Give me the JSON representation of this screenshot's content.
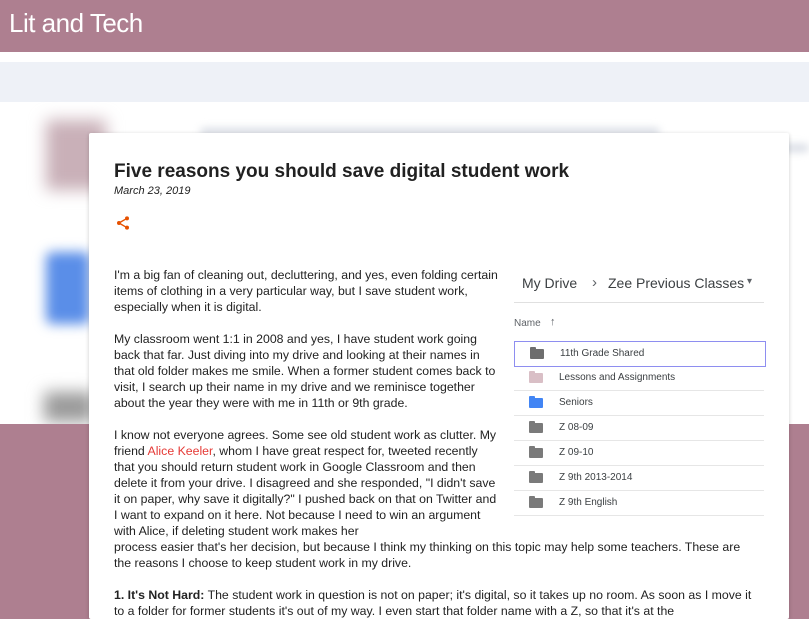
{
  "site": {
    "title": "Lit and Tech"
  },
  "post": {
    "title": "Five reasons you should save digital student work",
    "date": "March 23, 2019",
    "share_icon": "share-icon",
    "paragraphs": {
      "p1": "I'm a big fan of cleaning out, decluttering, and yes, even folding certain items of clothing in a very particular way, but I save student work, especially when it is digital.",
      "p2": "My classroom went 1:1 in 2008 and yes, I have student work going back that far. Just diving into my drive and looking at their names in that old folder makes me smile. When a former student comes back to visit, I search up their name in my drive and we reminisce together about the year they were with me in 11th or 9th grade.",
      "p3_before": "I know not everyone agrees. Some see old student work as clutter. My friend ",
      "p3_link": "Alice Keeler",
      "p3_after": ", whom I have great respect for, tweeted recently that you should return student work in Google Classroom and then delete it from your drive. I disagreed and she responded, \"I didn't save it on paper, why save it digitally?\" I pushed back on that on Twitter and I want to expand on it here. Not because I need to win an argument with Alice, if deleting student work makes her",
      "p4": "process easier that's her decision, but because I think my thinking on this topic may help some teachers. These are the reasons I choose to keep student work in my drive.",
      "p5_bold": "1. It's Not Hard:",
      "p5_text": " The student work in question is not on paper; it's digital, so it takes up no room. As soon as I move it to a folder for former students it's out of my way. I even start that folder name with a Z, so that it's at the"
    }
  },
  "drive": {
    "breadcrumb_root": "My Drive",
    "breadcrumb_sep": "›",
    "breadcrumb_current": "Zee Previous Classes",
    "breadcrumb_caret": "▾",
    "column_name": "Name",
    "sort_arrow": "↑",
    "folders": [
      {
        "label": "11th Grade Shared",
        "color": "#6e6e6e",
        "selected": true
      },
      {
        "label": "Lessons and Assignments",
        "color": "#d9bfc6",
        "selected": false
      },
      {
        "label": "Seniors",
        "color": "#4285f4",
        "selected": false
      },
      {
        "label": "Z 08-09",
        "color": "#7a7a7a",
        "selected": false
      },
      {
        "label": "Z 09-10",
        "color": "#7a7a7a",
        "selected": false
      },
      {
        "label": "Z 9th 2013-2014",
        "color": "#7a7a7a",
        "selected": false
      },
      {
        "label": "Z 9th English",
        "color": "#7a7a7a",
        "selected": false
      }
    ]
  },
  "colors": {
    "header": "#ae7f90",
    "link": "#e53935",
    "share": "#e65100"
  }
}
